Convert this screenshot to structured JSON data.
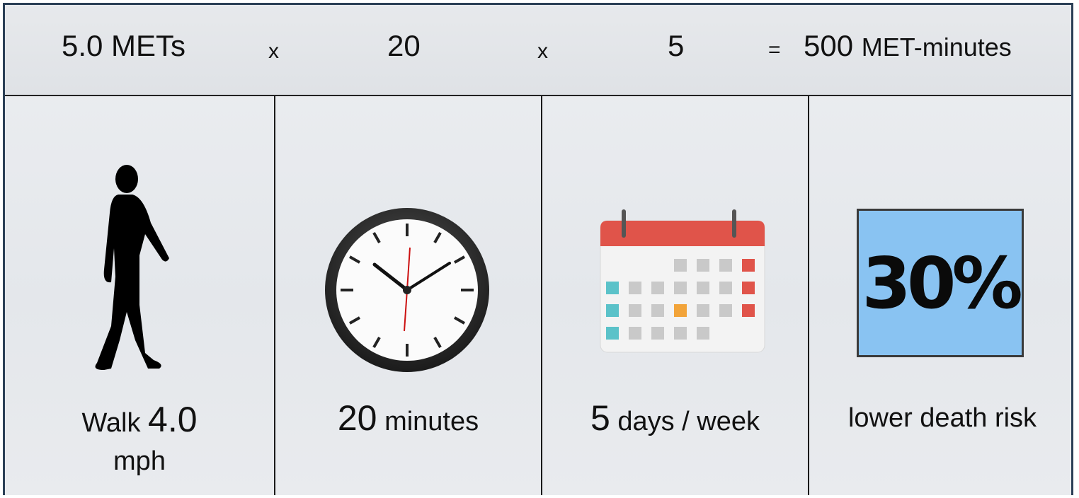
{
  "formula": {
    "mets": "5.0 METs",
    "times1": "x",
    "minutes": "20",
    "times2": "x",
    "days": "5",
    "equals": "=",
    "result_num": "500",
    "result_unit": "MET-minutes"
  },
  "panels": [
    {
      "icon": "walking-person-icon",
      "label_small": "Walk",
      "label_big": "4.0",
      "label_line2": "mph"
    },
    {
      "icon": "clock-icon",
      "label_big": "20",
      "label_small": "minutes"
    },
    {
      "icon": "calendar-icon",
      "label_big": "5",
      "label_small": "days / week"
    },
    {
      "icon": "percent-box",
      "value": "30%",
      "label": "lower death risk"
    }
  ],
  "colors": {
    "frame_border": "#2b3f56",
    "calendar_header": "#e0544a",
    "calendar_teal": "#5bc2c9",
    "calendar_orange": "#f2a43a",
    "calendar_gray": "#c9c9c9",
    "percent_box": "#89c3f2"
  }
}
